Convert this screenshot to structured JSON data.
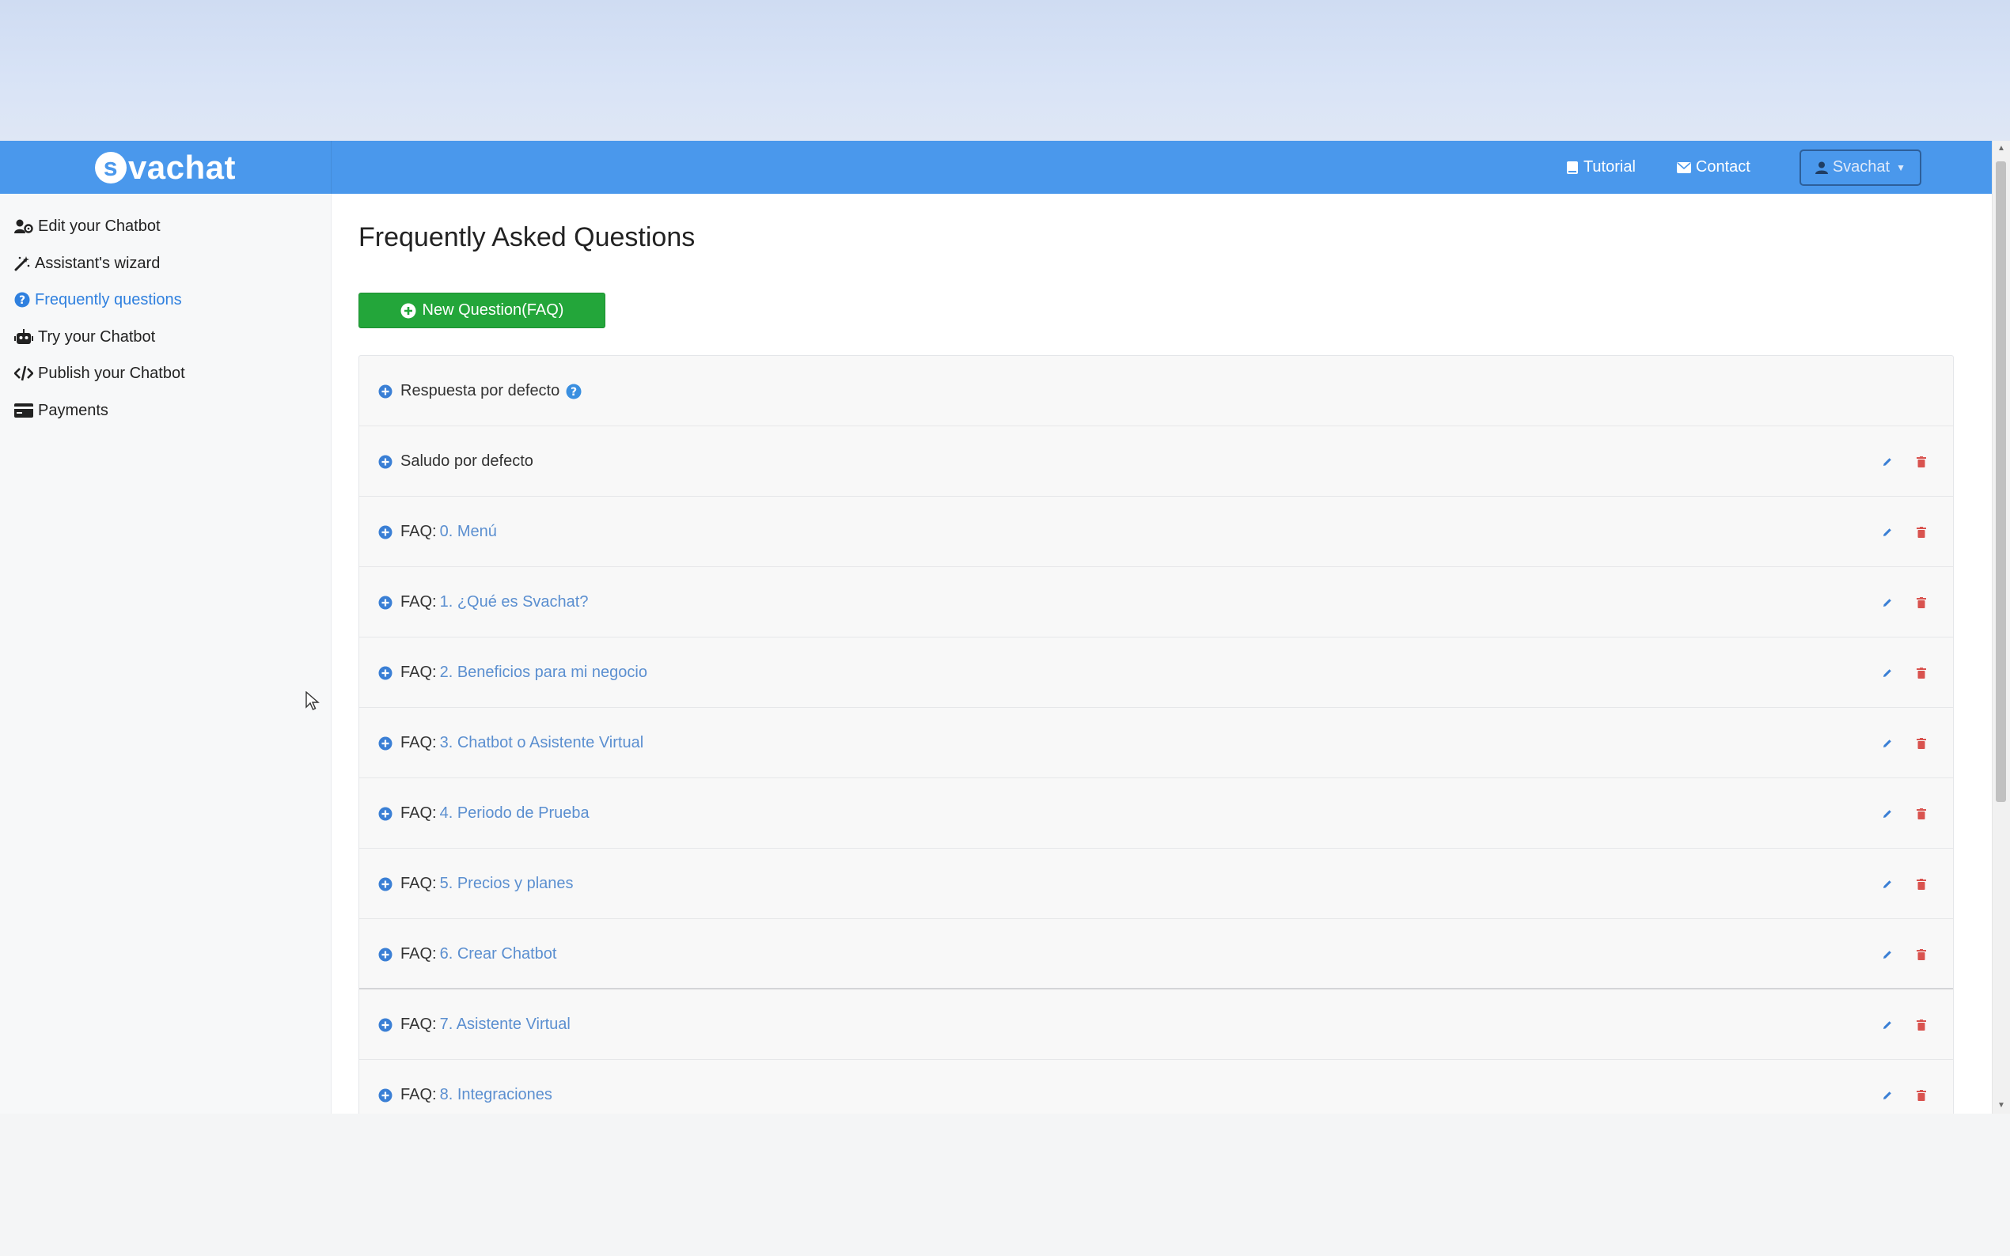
{
  "navbar": {
    "brand": "vachat",
    "brand_s": "s",
    "links": [
      {
        "label": "Tutorial",
        "icon": "book-icon"
      },
      {
        "label": "Contact",
        "icon": "envelope-icon"
      }
    ],
    "user_menu": {
      "label": "Svachat",
      "icon": "user-icon"
    }
  },
  "sidebar": {
    "items": [
      {
        "label": "Edit your Chatbot",
        "icon": "user-cog-icon",
        "active": false
      },
      {
        "label": "Assistant's wizard",
        "icon": "magic-wand-icon",
        "active": false
      },
      {
        "label": "Frequently questions",
        "icon": "question-circle-icon",
        "active": true
      },
      {
        "label": "Try your Chatbot",
        "icon": "robot-icon",
        "active": false
      },
      {
        "label": "Publish your Chatbot",
        "icon": "code-icon",
        "active": false
      },
      {
        "label": "Payments",
        "icon": "credit-card-icon",
        "active": false
      }
    ]
  },
  "main": {
    "title": "Frequently Asked Questions",
    "new_button": "New Question(FAQ)",
    "faq_prefix": "FAQ:",
    "default_rows": [
      {
        "label": "Respuesta por defecto",
        "has_help": true,
        "has_actions": false
      },
      {
        "label": "Saludo por defecto",
        "has_help": false,
        "has_actions": true
      }
    ],
    "faqs": [
      "0. Menú",
      "1. ¿Qué es Svachat?",
      "2. Beneficios para mi negocio",
      "3. Chatbot o Asistente Virtual",
      "4. Periodo de Prueba",
      "5. Precios y planes",
      "6. Crear Chatbot",
      "7. Asistente Virtual",
      "8. Integraciones"
    ]
  },
  "colors": {
    "navbar": "#4a98ec",
    "primary_link": "#5b8fd0",
    "active": "#2f80df",
    "success": "#23a63a",
    "edit": "#3a7fd5",
    "delete": "#d9534f"
  }
}
